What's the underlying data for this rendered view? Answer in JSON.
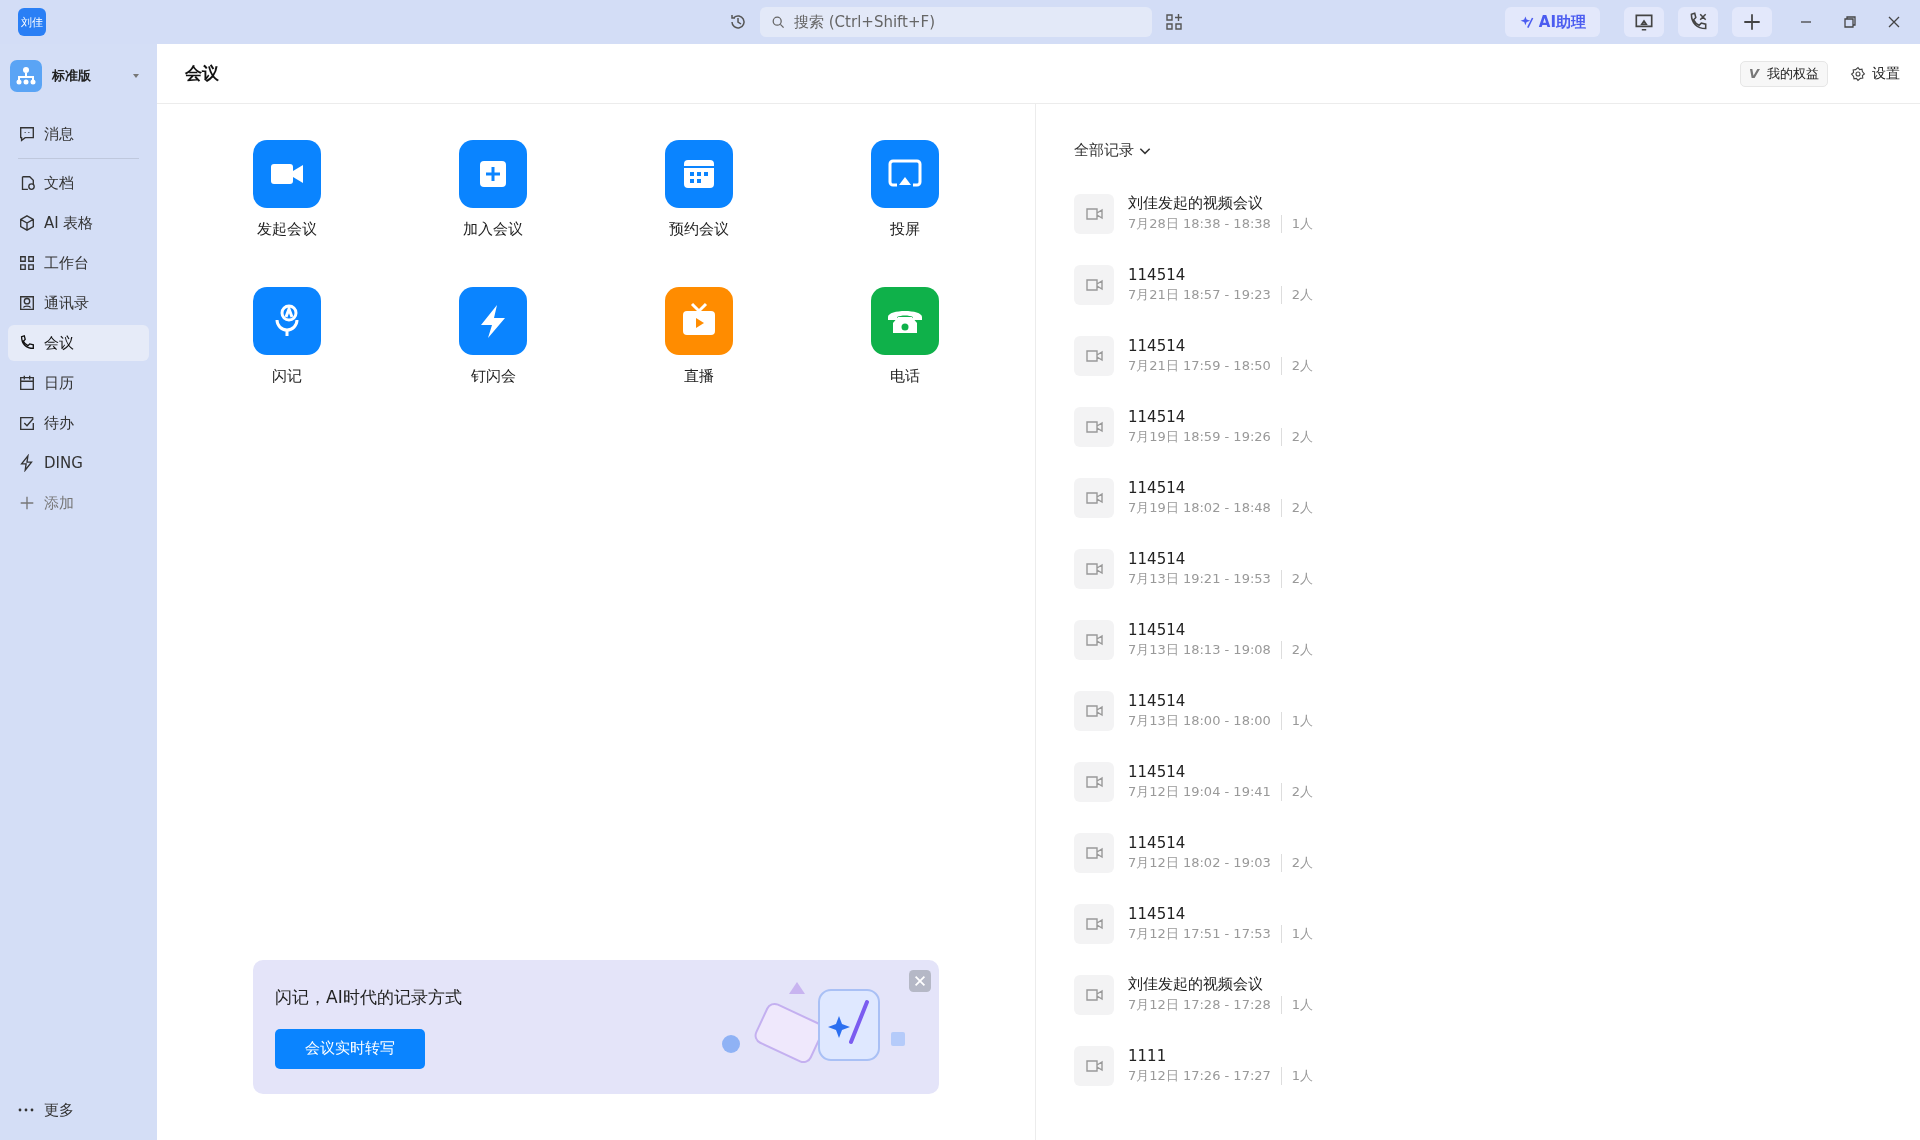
{
  "title_bar": {
    "logo": "刘佳",
    "search": {
      "placeholder": "搜索 (Ctrl+Shift+F)"
    },
    "ai_button": "AI助理"
  },
  "sidebar": {
    "org": "标准版",
    "pinned": [
      {
        "label": "消息",
        "selected": false
      }
    ],
    "items": [
      {
        "label": "文档",
        "selected": false
      },
      {
        "label": "AI 表格",
        "selected": false
      },
      {
        "label": "工作台",
        "selected": false
      },
      {
        "label": "通讯录",
        "selected": false
      },
      {
        "label": "会议",
        "selected": true
      },
      {
        "label": "日历",
        "selected": false
      },
      {
        "label": "待办",
        "selected": false
      },
      {
        "label": "DING",
        "selected": false
      },
      {
        "label": "添加",
        "selected": false
      }
    ],
    "more": "更多"
  },
  "header": {
    "title": "会议",
    "benefits_badge": "V",
    "benefits": "我的权益",
    "settings": "设置"
  },
  "actions": [
    {
      "label": "发起会议",
      "color": "#0a84ff"
    },
    {
      "label": "加入会议",
      "color": "#0a84ff"
    },
    {
      "label": "预约会议",
      "color": "#0a84ff"
    },
    {
      "label": "投屏",
      "color": "#0a84ff"
    },
    {
      "label": "闪记",
      "color": "#0a84ff"
    },
    {
      "label": "钉闪会",
      "color": "#0a84ff"
    },
    {
      "label": "直播",
      "color": "#ff8c00"
    },
    {
      "label": "电话",
      "color": "#0fb14a"
    }
  ],
  "banner": {
    "text": "闪记，AI时代的记录方式",
    "button": "会议实时转写"
  },
  "records": {
    "filter": "全部记录",
    "items": [
      {
        "title": "刘佳发起的视频会议",
        "time": "7月28日 18:38 - 18:38",
        "people": "1人"
      },
      {
        "title": "114514",
        "time": "7月21日 18:57 - 19:23",
        "people": "2人"
      },
      {
        "title": "114514",
        "time": "7月21日 17:59 - 18:50",
        "people": "2人"
      },
      {
        "title": "114514",
        "time": "7月19日 18:59 - 19:26",
        "people": "2人"
      },
      {
        "title": "114514",
        "time": "7月19日 18:02 - 18:48",
        "people": "2人"
      },
      {
        "title": "114514",
        "time": "7月13日 19:21 - 19:53",
        "people": "2人"
      },
      {
        "title": "114514",
        "time": "7月13日 18:13 - 19:08",
        "people": "2人"
      },
      {
        "title": "114514",
        "time": "7月13日 18:00 - 18:00",
        "people": "1人"
      },
      {
        "title": "114514",
        "time": "7月12日 19:04 - 19:41",
        "people": "2人"
      },
      {
        "title": "114514",
        "time": "7月12日 18:02 - 19:03",
        "people": "2人"
      },
      {
        "title": "114514",
        "time": "7月12日 17:51 - 17:53",
        "people": "1人"
      },
      {
        "title": "刘佳发起的视频会议",
        "time": "7月12日 17:28 - 17:28",
        "people": "1人"
      },
      {
        "title": "1111",
        "time": "7月12日 17:26 - 17:27",
        "people": "1人"
      }
    ]
  }
}
